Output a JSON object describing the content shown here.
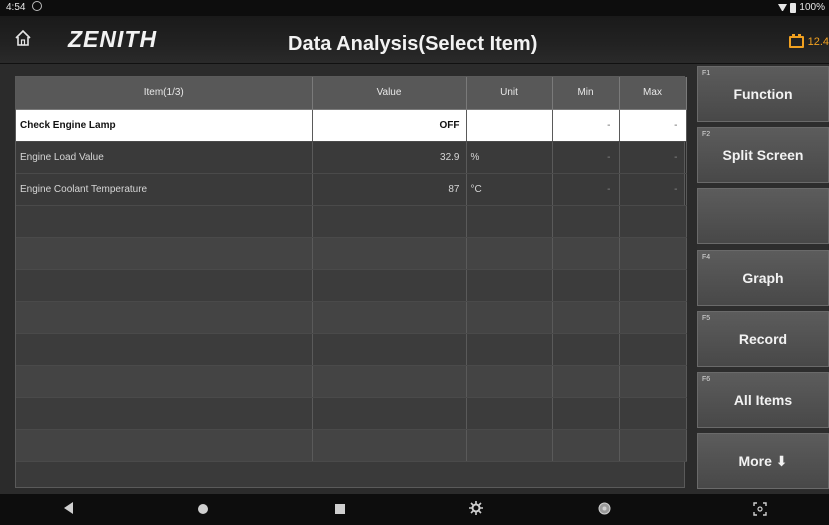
{
  "status_bar": {
    "time": "4:54",
    "battery": "100%"
  },
  "header": {
    "logo": "ZENITH",
    "title": "Data Analysis(Select Item)",
    "voltage": "12.4"
  },
  "table": {
    "headers": [
      "Item(1/3)",
      "Value",
      "Unit",
      "Min",
      "Max"
    ],
    "rows": [
      {
        "item": "Check Engine Lamp",
        "value": "OFF",
        "unit": "",
        "min": "-",
        "max": "-"
      },
      {
        "item": "Engine Load Value",
        "value": "32.9",
        "unit": "%",
        "min": "-",
        "max": "-"
      },
      {
        "item": "Engine Coolant Temperature",
        "value": "87",
        "unit": "°C",
        "min": "-",
        "max": "-"
      }
    ]
  },
  "side_buttons": [
    {
      "key": "F1",
      "label": "Function"
    },
    {
      "key": "F2",
      "label": "Split Screen"
    },
    {
      "key": "",
      "label": ""
    },
    {
      "key": "F4",
      "label": "Graph"
    },
    {
      "key": "F5",
      "label": "Record"
    },
    {
      "key": "F6",
      "label": "All Items"
    },
    {
      "key": "",
      "label": "More ⬇"
    }
  ],
  "icons": [
    "home-icon",
    "back-icon",
    "home-circle-icon",
    "recents-icon",
    "settings-icon",
    "browser-icon",
    "screenshot-icon"
  ]
}
